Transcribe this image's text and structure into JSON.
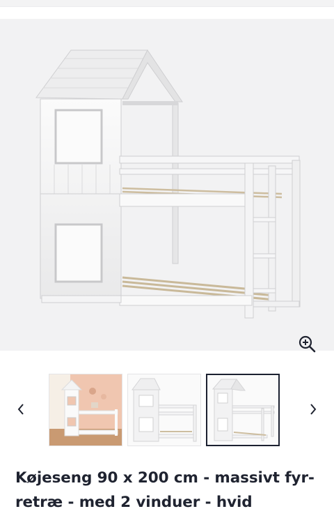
{
  "gallery": {
    "zoom_icon": "magnify-plus-icon",
    "prev_icon": "chevron-left-icon",
    "next_icon": "chevron-right-icon",
    "active_thumbnail": 3,
    "thumbnails": [
      {
        "alt": "room-scene"
      },
      {
        "alt": "front-view"
      },
      {
        "alt": "angled-view"
      }
    ]
  },
  "product": {
    "title_line1": "Køjeseng 90 x 200 cm - massivt fyr-",
    "title_line2": "retræ - med 2 vinduer - hvid"
  },
  "colors": {
    "title_text": "#1f2330",
    "hero_background": "#f2f2f3",
    "active_border": "#1b2030"
  }
}
